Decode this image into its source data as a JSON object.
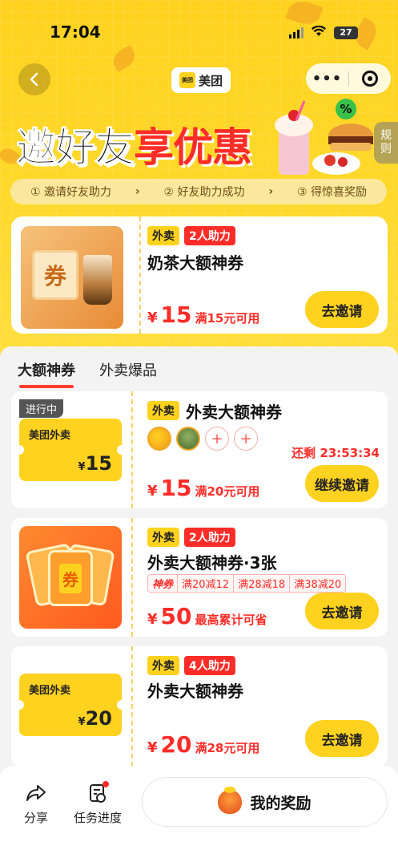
{
  "status_bar": {
    "time": "17:04",
    "battery": "27"
  },
  "nav": {
    "brand": "美团",
    "brand_logo_text": "美团",
    "more": "•••"
  },
  "hero": {
    "title_part1": "邀好友",
    "title_part2": "享优惠",
    "rules_label": [
      "规",
      "则"
    ],
    "steps": [
      "① 邀请好友助力",
      "② 好友助力成功",
      "③ 得惊喜奖励"
    ],
    "step_arrow": "›"
  },
  "featured": {
    "tag": "外卖",
    "help_tag": "2人助力",
    "name": "奶茶大额神券",
    "price": "15",
    "currency": "¥",
    "condition": "满15元可用",
    "button": "去邀请",
    "image_text": "券"
  },
  "tabs": [
    {
      "label": "大额神券",
      "active": true
    },
    {
      "label": "外卖爆品",
      "active": false
    }
  ],
  "cards": [
    {
      "status": "进行中",
      "ticket_label": "美团外卖",
      "ticket_currency": "¥",
      "ticket_amount": "15",
      "tag": "外卖",
      "name": "外卖大额神券",
      "countdown": "还剩 23:53:34",
      "currency": "¥",
      "price": "15",
      "condition": "满20元可用",
      "button": "继续邀请"
    },
    {
      "tag": "外卖",
      "help_tag": "2人助力",
      "name": "外卖大额神券·3张",
      "image_text": "券",
      "sub_tags": [
        "神券",
        "满20减12",
        "满28减18",
        "满38减20"
      ],
      "currency": "¥",
      "price": "50",
      "condition": "最高累计可省",
      "button": "去邀请"
    },
    {
      "ticket_label": "美团外卖",
      "ticket_currency": "¥",
      "ticket_amount": "20",
      "tag": "外卖",
      "help_tag": "4人助力",
      "name": "外卖大额神券",
      "currency": "¥",
      "price": "20",
      "condition": "满28元可用",
      "button": "去邀请"
    }
  ],
  "bottom_bar": {
    "share": "分享",
    "progress": "任务进度",
    "rewards": "我的奖励"
  },
  "colors": {
    "brand_yellow": "#ffd21f",
    "accent_red": "#ff2d28"
  }
}
